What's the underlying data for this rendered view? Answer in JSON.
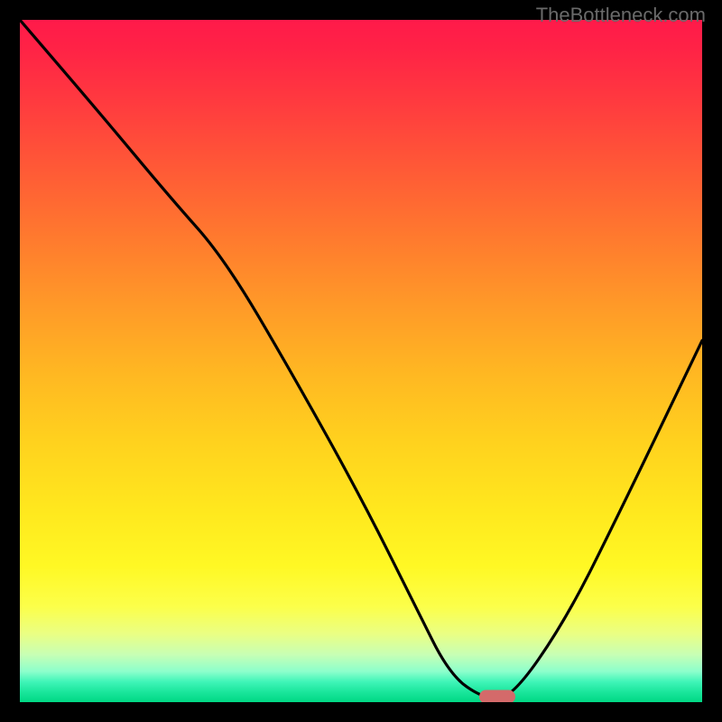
{
  "watermark": "TheBottleneck.com",
  "chart_data": {
    "type": "line",
    "title": "",
    "xlabel": "",
    "ylabel": "",
    "xlim": [
      0,
      100
    ],
    "ylim": [
      0,
      100
    ],
    "series": [
      {
        "name": "curve",
        "x": [
          0,
          12,
          22,
          30,
          40,
          50,
          58,
          63,
          68,
          72,
          80,
          88,
          100
        ],
        "values": [
          100,
          86,
          74,
          65,
          48,
          30,
          14,
          4,
          0.5,
          0.5,
          12,
          28,
          53
        ]
      }
    ],
    "marker": {
      "x": 70,
      "y": 0.8
    },
    "gradient_stops": [
      {
        "pos": 0,
        "color": "#ff1a4a"
      },
      {
        "pos": 50,
        "color": "#ffb822"
      },
      {
        "pos": 80,
        "color": "#fff824"
      },
      {
        "pos": 100,
        "color": "#00d884"
      }
    ]
  }
}
